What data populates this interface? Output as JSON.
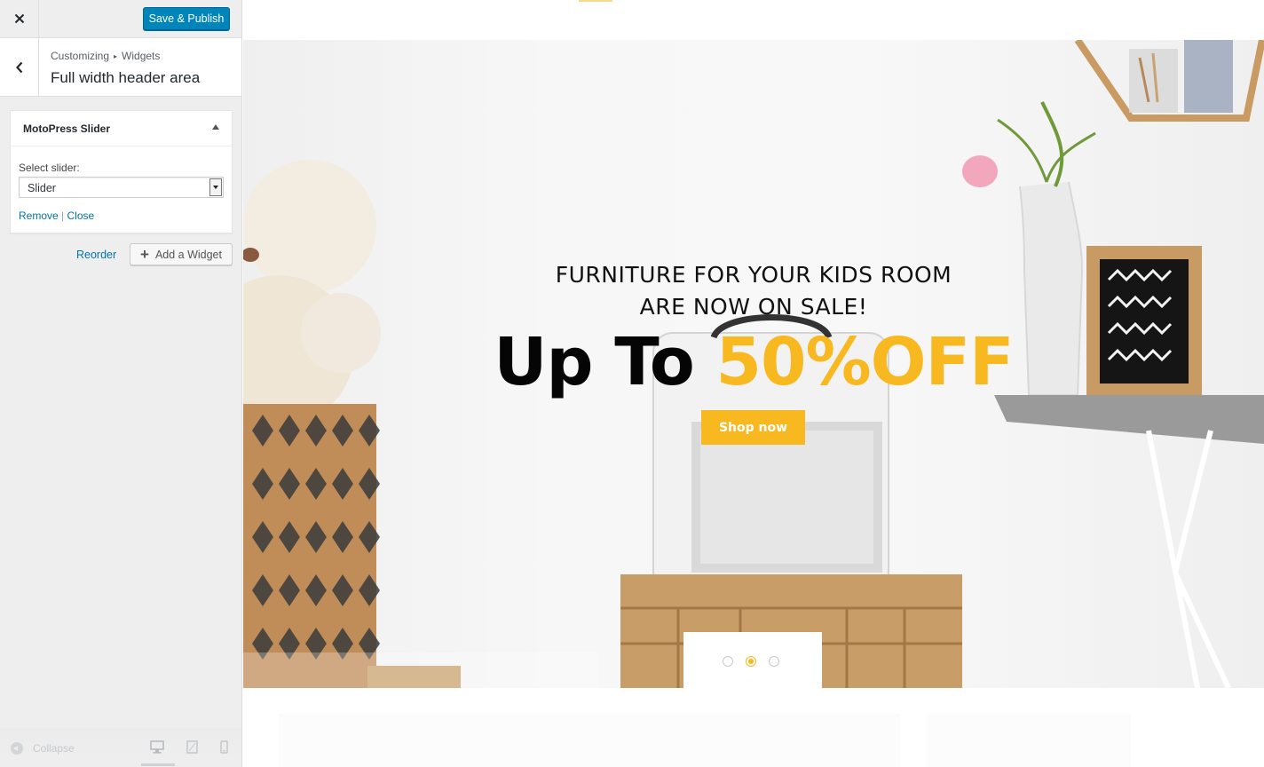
{
  "topbar": {
    "close_icon": "close-icon",
    "save_label": "Save & Publish",
    "accent_color": "#0085ba"
  },
  "section": {
    "breadcrumb_root": "Customizing",
    "breadcrumb_child": "Widgets",
    "title": "Full width header area"
  },
  "widget": {
    "title": "MotoPress Slider",
    "select_label": "Select slider:",
    "select_value": "Slider",
    "remove_label": "Remove",
    "separator": "|",
    "close_label": "Close"
  },
  "actions": {
    "reorder_label": "Reorder",
    "add_widget_label": "Add a Widget"
  },
  "footer": {
    "collapse_label": "Collapse",
    "devices": [
      "desktop",
      "tablet",
      "mobile"
    ],
    "active_device": "desktop"
  },
  "preview": {
    "hero_line1": "FURNITURE FOR YOUR KIDS ROOM",
    "hero_line2": "ARE NOW ON SALE!",
    "hero_big_a": "Up To ",
    "hero_big_b": "50%OFF",
    "shop_button": "Shop now",
    "accent_color": "#f8b81f",
    "slider_dots": 3,
    "active_slide": 2
  }
}
